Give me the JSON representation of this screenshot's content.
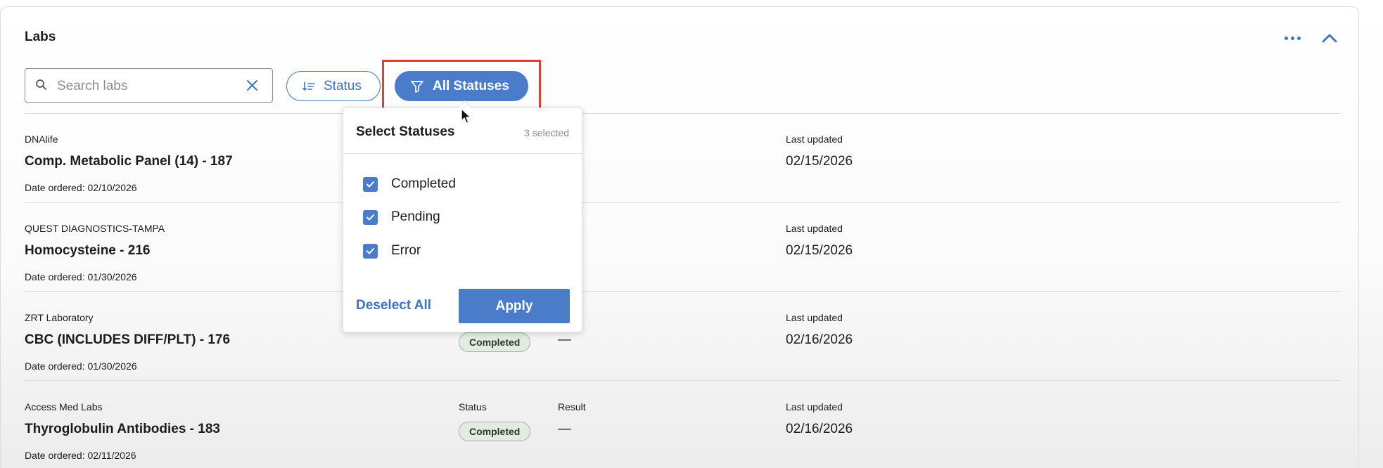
{
  "panel": {
    "title": "Labs"
  },
  "search": {
    "placeholder": "Search labs"
  },
  "filters": {
    "status_label": "Status",
    "all_statuses_label": "All Statuses"
  },
  "columns": {
    "status": "Status",
    "result": "Result",
    "last_updated": "Last updated"
  },
  "rows": [
    {
      "lab": "DNAlife",
      "name": "Comp. Metabolic Panel (14) - 187",
      "date": "Date ordered: 02/10/2026",
      "status": "",
      "result": "",
      "updated": "02/15/2026"
    },
    {
      "lab": "QUEST DIAGNOSTICS-TAMPA",
      "name": "Homocysteine - 216",
      "date": "Date ordered: 01/30/2026",
      "status": "",
      "result": "",
      "updated": "02/15/2026"
    },
    {
      "lab": "ZRT Laboratory",
      "name": "CBC (INCLUDES DIFF/PLT) - 176",
      "date": "Date ordered: 01/30/2026",
      "status": "Completed",
      "result": "—",
      "updated": "02/16/2026"
    },
    {
      "lab": "Access Med Labs",
      "name": "Thyroglobulin Antibodies - 183",
      "date": "Date ordered: 02/11/2026",
      "status": "Completed",
      "result": "—",
      "updated": "02/16/2026"
    }
  ],
  "dropdown": {
    "title": "Select Statuses",
    "count": "3 selected",
    "options": [
      {
        "label": "Completed",
        "checked": true
      },
      {
        "label": "Pending",
        "checked": true
      },
      {
        "label": "Error",
        "checked": true
      }
    ],
    "deselect_label": "Deselect All",
    "apply_label": "Apply"
  },
  "colors": {
    "accent": "#4a7cc9",
    "highlight": "#e0412e",
    "badge_bg": "#e3ece0"
  },
  "icons": {
    "search": "search-icon",
    "clear": "close-icon",
    "sort": "sort-list-icon",
    "filter": "filter-icon",
    "more": "more-horizontal-icon",
    "collapse": "chevron-up-icon",
    "check": "checkmark-icon",
    "cursor": "mouse-cursor-icon"
  }
}
